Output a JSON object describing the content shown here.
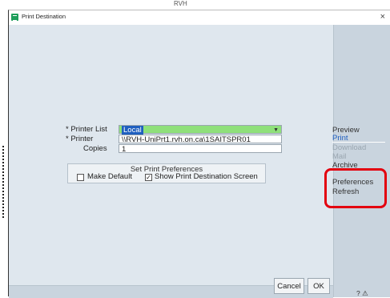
{
  "background": {
    "partial_text": "RVH"
  },
  "window": {
    "title": "Print Destination",
    "close_glyph": "×"
  },
  "form": {
    "printer_list_label": "* Printer List",
    "printer_list_value": "Local",
    "printer_label": "* Printer",
    "printer_value": "\\\\RVH-UniPrt1.rvh.on.ca\\1SAITSPR01",
    "copies_label": "Copies",
    "copies_value": "1"
  },
  "preferences": {
    "title": "Set Print Preferences",
    "make_default_label": "Make Default",
    "make_default_checked": false,
    "show_destination_label": "Show Print Destination Screen",
    "show_destination_checked": true
  },
  "sidebar": {
    "items": [
      {
        "label": "Preview",
        "state": "normal"
      },
      {
        "label": "Print",
        "state": "active"
      },
      {
        "label": "Download",
        "state": "disabled"
      },
      {
        "label": "Mail",
        "state": "disabled"
      },
      {
        "label": "Archive",
        "state": "normal"
      },
      {
        "label": "Preferences",
        "state": "normal"
      },
      {
        "label": "Refresh",
        "state": "normal"
      }
    ],
    "help": "? ⚠"
  },
  "buttons": {
    "cancel": "Cancel",
    "ok": "OK"
  },
  "colors": {
    "accent": "#1f5fbf",
    "highlight": "#e3000f",
    "select_bg": "#8fe07a"
  }
}
